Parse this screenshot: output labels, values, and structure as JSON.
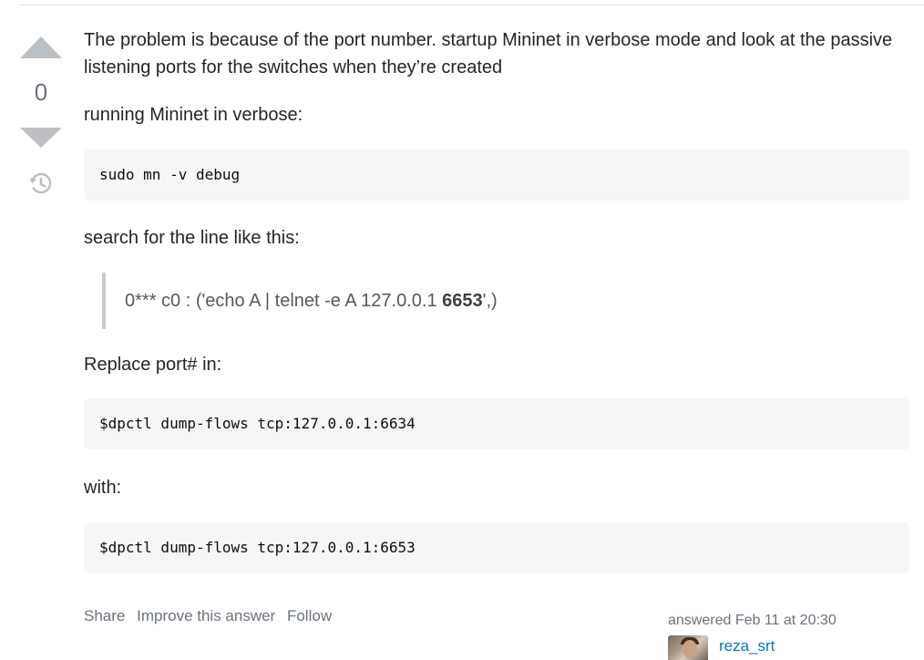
{
  "vote": {
    "count": "0"
  },
  "post": {
    "intro": "The problem is because of the port number. startup Mininet in verbose mode and look at the passive listening ports for the switches when they’re created",
    "running_label": "running Mininet in verbose:",
    "code1": "sudo mn -v debug",
    "search_label": "search for the line like this:",
    "quote_prefix": "0*** c0 : ('echo A | telnet -e A 127.0.0.1 ",
    "quote_bold": "6653",
    "quote_suffix": "',)",
    "replace_label": "Replace port# in:",
    "code2": "$dpctl dump-flows tcp:127.0.0.1:6634",
    "with_label": "with:",
    "code3": "$dpctl dump-flows tcp:127.0.0.1:6653"
  },
  "menu": {
    "share": "Share",
    "improve": "Improve this answer",
    "follow": "Follow"
  },
  "signature": {
    "answered": "answered Feb 11 at 20:30",
    "username": "reza_srt"
  },
  "icons": {
    "history": "history-icon",
    "vote_up": "arrow-up-icon",
    "vote_down": "arrow-down-icon"
  },
  "colors": {
    "link": "#0074cc",
    "vote_arrow": "#bbc0c4",
    "code_bg": "#f6f6f6"
  }
}
